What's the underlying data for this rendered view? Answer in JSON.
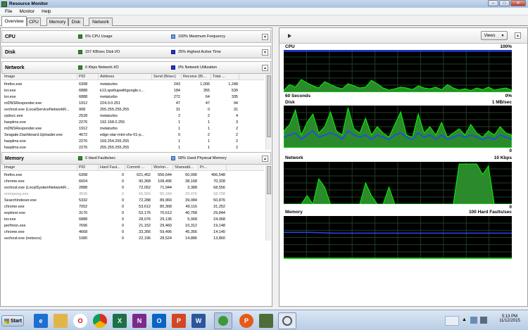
{
  "window": {
    "title": "Resource Monitor",
    "minimize": "–",
    "maximize": "□",
    "close": "✕"
  },
  "menu": [
    "File",
    "Monitor",
    "Help"
  ],
  "tabs": [
    "Overview",
    "CPU",
    "Memory",
    "Disk",
    "Network"
  ],
  "active_tab": 0,
  "sections": {
    "cpu": {
      "name": "CPU",
      "stat1": "5% CPU Usage",
      "stat2": "100% Maximum Frequency"
    },
    "disk": {
      "name": "Disk",
      "stat1": "157 KB/sec Disk I/O",
      "stat2": "25% Highest Active Time"
    },
    "network": {
      "name": "Network",
      "stat1": "0 Kbps Network I/O",
      "stat2": "0% Network Utilization"
    },
    "memory": {
      "name": "Memory",
      "stat1": "0 Hard Faults/sec",
      "stat2": "58% Used Physical Memory"
    }
  },
  "network_table": {
    "columns": [
      "Image",
      "PID",
      "Address",
      "Send (B/sec)",
      "Receive (B/...",
      "Total ..."
    ],
    "rows": [
      [
        "firefox.exe",
        "6308",
        "metaturbo",
        "243",
        "1,006",
        "1,248"
      ],
      [
        "tor.exe",
        "6888",
        "k13.spellupwithgoogle.c...",
        "184",
        "355",
        "539"
      ],
      [
        "tor.exe",
        "6888",
        "metaturbo",
        "272",
        "64",
        "335"
      ],
      [
        "mDNSResponder.exe",
        "1912",
        "224.0.0.251",
        "47",
        "47",
        "94"
      ],
      [
        "svchost.exe (LocalServiceNetworkR...",
        "908",
        "255.255.255.255",
        "31",
        "0",
        "31"
      ],
      [
        "rpdsvc.exe",
        "2528",
        "metaturbo",
        "2",
        "2",
        "4"
      ],
      [
        "hasplms.exe",
        "2276",
        "192.168.0.255",
        "1",
        "1",
        "3"
      ],
      [
        "mDNSResponder.exe",
        "1912",
        "metaturbo",
        "1",
        "1",
        "2"
      ],
      [
        "Seagate.Dashboard.Uploader.exe",
        "4672",
        "edge-star-mini-shv-01-p...",
        "0",
        "2",
        "2"
      ],
      [
        "hasplms.exe",
        "2276",
        "169.254.255.255",
        "1",
        "1",
        "2"
      ],
      [
        "hasplms.exe",
        "2276",
        "255.255.255.255",
        "1",
        "1",
        "2"
      ]
    ]
  },
  "memory_table": {
    "columns": [
      "Image",
      "PID",
      "Hard Faul...",
      "Commit ...",
      "Workin...",
      "Shareabl...",
      "Pr..."
    ],
    "rows": [
      [
        "firefox.exe",
        "6308",
        "0",
        "621,452",
        "556,644",
        "60,096",
        "496,548"
      ],
      [
        "chrome.exe",
        "6604",
        "0",
        "90,368",
        "108,496",
        "38,168",
        "70,328"
      ],
      [
        "svchost.exe (LocalSystemNetworkR...",
        "2888",
        "0",
        "72,052",
        "71,944",
        "3,388",
        "68,556"
      ],
      [
        "msmpeng.exe",
        "3536",
        "0",
        "66,560",
        "85,184",
        "26,476",
        "58,708"
      ],
      [
        "SearchIndexer.exe",
        "5332",
        "0",
        "72,288",
        "89,960",
        "39,084",
        "50,876"
      ],
      [
        "chrome.exe",
        "7052",
        "0",
        "53,612",
        "80,368",
        "49,116",
        "31,252"
      ],
      [
        "explorer.exe",
        "3176",
        "0",
        "53,176",
        "70,612",
        "40,768",
        "29,844"
      ],
      [
        "tor.exe",
        "6888",
        "0",
        "28,076",
        "29,136",
        "5,068",
        "24,068"
      ],
      [
        "perfmon.exe",
        "7696",
        "0",
        "21,152",
        "29,460",
        "10,312",
        "19,148"
      ],
      [
        "chrome.exe",
        "4668",
        "0",
        "33,356",
        "59,496",
        "45,356",
        "14,140"
      ],
      [
        "svchost.exe (netsvcs)",
        "1080",
        "0",
        "22,196",
        "28,524",
        "14,886",
        "13,860"
      ]
    ]
  },
  "graphs": {
    "views_label": "Views",
    "cpu": {
      "label": "CPU",
      "max": "100%",
      "time": "60 Seconds",
      "min": "0%"
    },
    "disk": {
      "label": "Disk",
      "max": "1 MB/sec",
      "min": "0"
    },
    "network": {
      "label": "Network",
      "max": "10 Kbps",
      "min": "0"
    },
    "memory": {
      "label": "Memory",
      "max": "100 Hard Faults/sec"
    }
  },
  "taskbar": {
    "start": "Start",
    "apps": [
      "ie-icon",
      "folder-icon",
      "opera-icon",
      "chrome-icon",
      "excel-icon",
      "onenote-icon",
      "outlook-icon",
      "powerpoint-icon",
      "word-icon",
      "globe-icon",
      "pdf-icon",
      "monitor-icon",
      "resource-monitor-icon"
    ],
    "time": "5:13 PM",
    "date": "11/12/2015"
  },
  "colors": {
    "graph_bg": "#000000",
    "graph_line": "#00ff00",
    "graph_fill": "#2b8a2b",
    "series_blue": "#2346ff"
  }
}
